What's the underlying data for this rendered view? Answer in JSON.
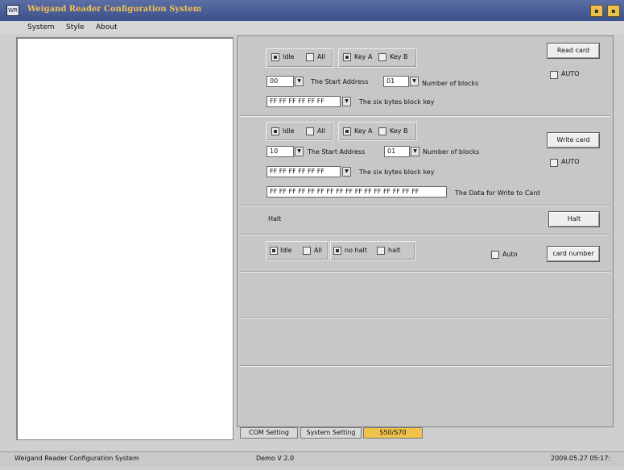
{
  "window": {
    "title": "Weigand Reader Configuration System",
    "icon_text": "WR",
    "minimize_glyph": "▪",
    "close_glyph": "▪"
  },
  "menu": [
    "System",
    "Style",
    "About"
  ],
  "read": {
    "chk_idle": "Idle",
    "chk_all": "All",
    "chk_keya": "Key A",
    "chk_keyb": "Key B",
    "start_value": "00",
    "start_label": "The Start Address",
    "blocks_value": "01",
    "blocks_label": "Number of blocks",
    "key_value": "FF FF FF FF FF FF",
    "key_label": "The six bytes block key",
    "button": "Read card",
    "auto_label": "AUTO"
  },
  "write": {
    "chk_idle": "Idle",
    "chk_all": "All",
    "chk_keya": "Key A",
    "chk_keyb": "Key B",
    "start_value": "10",
    "start_label": "The Start Address",
    "blocks_value": "01",
    "blocks_label": "Number of blocks",
    "key_value": "FF FF FF FF FF FF",
    "key_label": "The six bytes block key",
    "data_value": "FF FF FF FF FF FF FF FF FF FF FF FF FF FF FF FF",
    "data_label": "The Data for Write to Card",
    "button": "Write card",
    "auto_label": "AUTO"
  },
  "halt": {
    "label": "Halt",
    "button": "Halt"
  },
  "cardnum": {
    "chk_idle": "Idle",
    "chk_all": "All",
    "chk_nohalt": "no halt",
    "chk_halt": "halt",
    "auto_label": "Auto",
    "button": "card number"
  },
  "tabs": [
    "COM Setting",
    "System Setting",
    "S50/S70"
  ],
  "active_tab": "S50/S70",
  "status": {
    "left": "Weigand Reader Configuration System",
    "middle": "Demo  V 2.0",
    "right": "2009.05.27  05:17:"
  },
  "colors": {
    "title_text": "#f4c050",
    "active_tab": "#f0c24a",
    "titlebar": "#3b4f8a"
  }
}
